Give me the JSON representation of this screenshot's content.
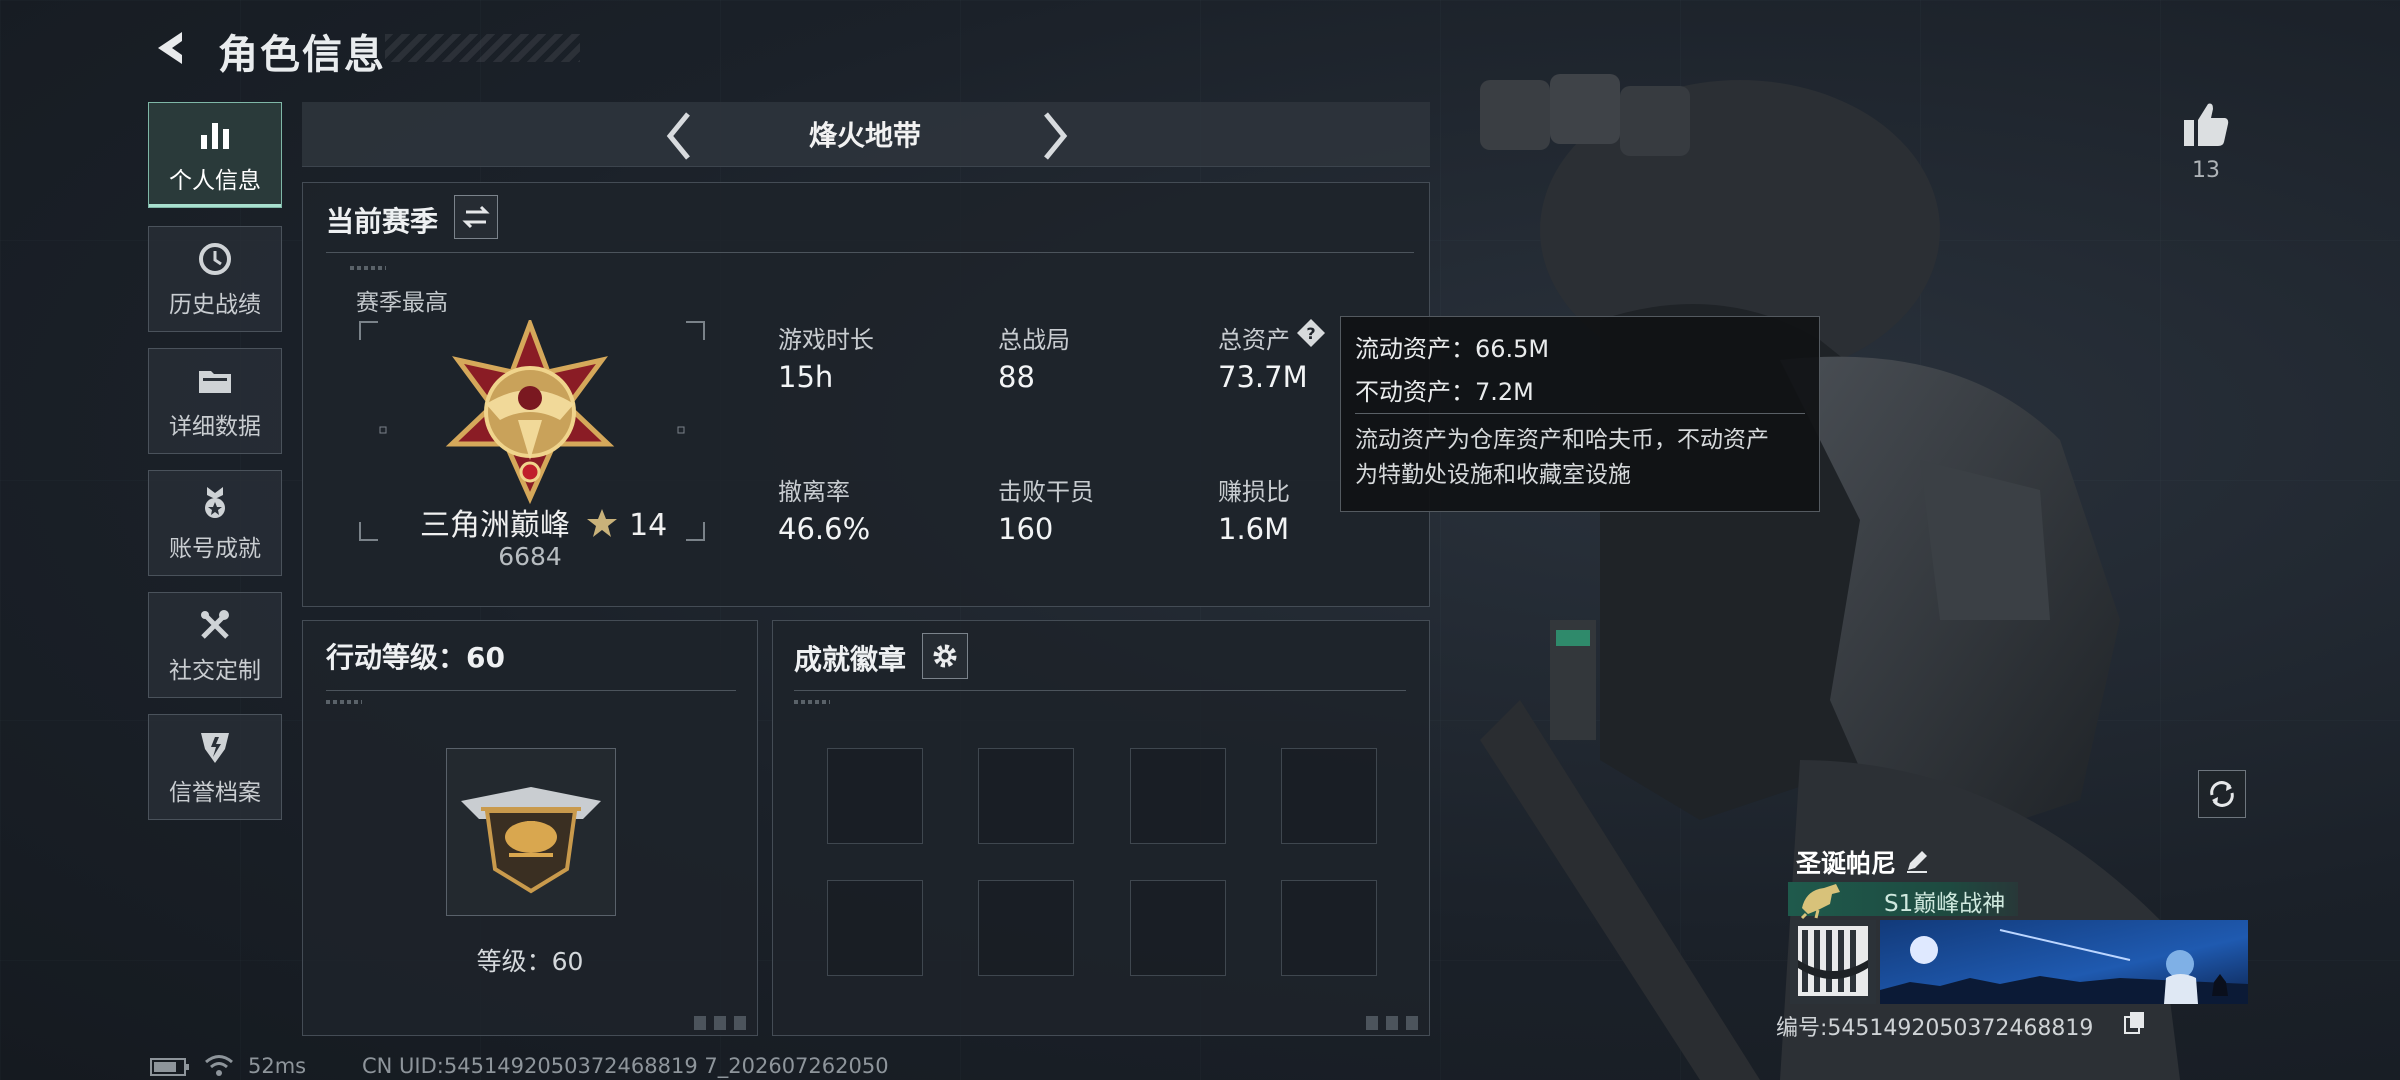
{
  "header": {
    "title": "角色信息"
  },
  "sidebar": {
    "items": [
      {
        "label": "个人信息",
        "icon": "bar-chart-icon",
        "active": true
      },
      {
        "label": "历史战绩",
        "icon": "history-icon",
        "active": false
      },
      {
        "label": "详细数据",
        "icon": "folder-icon",
        "active": false
      },
      {
        "label": "账号成就",
        "icon": "medal-icon",
        "active": false
      },
      {
        "label": "社交定制",
        "icon": "tools-icon",
        "active": false
      },
      {
        "label": "信誉档案",
        "icon": "shield-icon",
        "active": false
      }
    ]
  },
  "mode": {
    "title": "烽火地带"
  },
  "season": {
    "title": "当前赛季",
    "best_label": "赛季最高",
    "rank_name": "三角洲巅峰",
    "rank_stars": "14",
    "rank_score": "6684",
    "stats": [
      {
        "label": "游戏时长",
        "value": "15h"
      },
      {
        "label": "总战局",
        "value": "88"
      },
      {
        "label": "总资产",
        "value": "73.7M"
      },
      {
        "label": "撤离率",
        "value": "46.6%"
      },
      {
        "label": "击败干员",
        "value": "160"
      },
      {
        "label": "赚损比",
        "value": "1.6M"
      }
    ]
  },
  "tooltip": {
    "liquid": "流动资产：66.5M",
    "fixed": "不动资产：7.2M",
    "desc_line1": "流动资产为仓库资产和哈夫币，不动资产",
    "desc_line2": "为特勤处设施和收藏室设施"
  },
  "level": {
    "title": "行动等级：60",
    "caption": "等级：60"
  },
  "badges": {
    "title": "成就徽章",
    "slot_count": 8
  },
  "profile": {
    "likes": "13",
    "name": "圣诞帕尼",
    "title_text": "S1巅峰战神",
    "id_text": "编号:5451492050372468819"
  },
  "status": {
    "ping": "52ms",
    "uid": "CN UID:5451492050372468819 7_202607262050"
  },
  "colors": {
    "accent": "#a9e0cf",
    "title_green": "#1f5a4c",
    "panel": "#1e232a"
  }
}
